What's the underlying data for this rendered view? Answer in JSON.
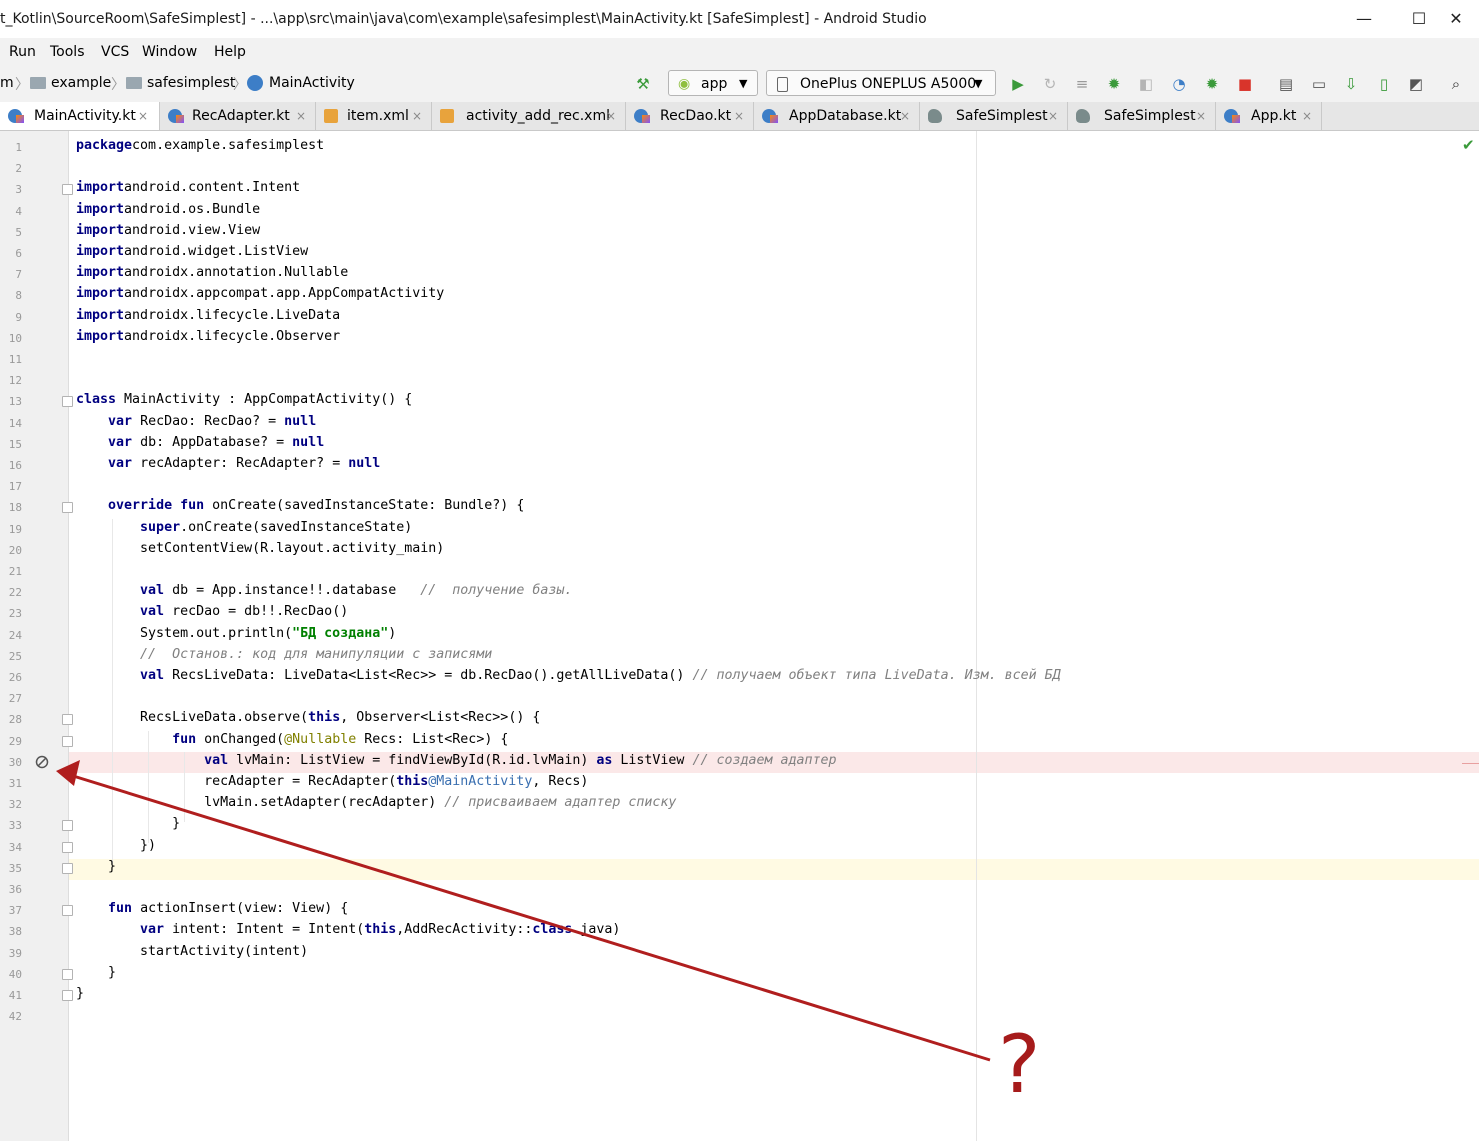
{
  "window": {
    "title": "t_Kotlin\\SourceRoom\\SafeSimplest] - ...\\app\\src\\main\\java\\com\\example\\safesimplest\\MainActivity.kt [SafeSimplest] - Android Studio",
    "minimize": "—",
    "maximize": "☐",
    "close": "✕"
  },
  "menu": [
    "Run",
    "Tools",
    "VCS",
    "Window",
    "Help"
  ],
  "breadcrumb": [
    "m",
    "example",
    "safesimplest",
    "MainActivity"
  ],
  "toolbar": {
    "config": "app",
    "device": "OnePlus ONEPLUS A5000"
  },
  "tabs": [
    {
      "label": "MainActivity.kt",
      "icon": "kotlin-class-icon"
    },
    {
      "label": "RecAdapter.kt",
      "icon": "kotlin-class-icon"
    },
    {
      "label": "item.xml",
      "icon": "xml-file-icon"
    },
    {
      "label": "activity_add_rec.xml",
      "icon": "xml-file-icon"
    },
    {
      "label": "RecDao.kt",
      "icon": "kotlin-class-icon"
    },
    {
      "label": "AppDatabase.kt",
      "icon": "kotlin-class-icon"
    },
    {
      "label": "SafeSimplest",
      "icon": "project-icon"
    },
    {
      "label": "SafeSimplest",
      "icon": "project-icon"
    },
    {
      "label": "App.kt",
      "icon": "kotlin-class-icon"
    }
  ],
  "close_glyph": "×",
  "code": {
    "lines": [
      [
        [
          "kw",
          "package"
        ],
        [
          "",
          "com.example.safesimplest"
        ]
      ],
      [],
      [
        [
          "kw",
          "import"
        ],
        [
          "",
          "android.content.Intent"
        ]
      ],
      [
        [
          "kw",
          "import"
        ],
        [
          "",
          "android.os.Bundle"
        ]
      ],
      [
        [
          "kw",
          "import"
        ],
        [
          "",
          "android.view.View"
        ]
      ],
      [
        [
          "kw",
          "import"
        ],
        [
          "",
          "android.widget.ListView"
        ]
      ],
      [
        [
          "kw",
          "import"
        ],
        [
          "",
          "androidx.annotation.Nullable"
        ]
      ],
      [
        [
          "kw",
          "import"
        ],
        [
          "",
          "androidx.appcompat.app.AppCompatActivity"
        ]
      ],
      [
        [
          "kw",
          "import"
        ],
        [
          "",
          "androidx.lifecycle.LiveData"
        ]
      ],
      [
        [
          "kw",
          "import"
        ],
        [
          "",
          "androidx.lifecycle.Observer"
        ]
      ],
      [],
      [],
      [
        [
          "kw",
          "class"
        ],
        [
          "",
          " MainActivity : AppCompatActivity() {"
        ]
      ],
      [
        [
          "",
          "    "
        ],
        [
          "kw",
          "var"
        ],
        [
          "",
          " RecDao: RecDao? = "
        ],
        [
          "kw",
          "null"
        ]
      ],
      [
        [
          "",
          "    "
        ],
        [
          "kw",
          "var"
        ],
        [
          "",
          " db: AppDatabase? = "
        ],
        [
          "kw",
          "null"
        ]
      ],
      [
        [
          "",
          "    "
        ],
        [
          "kw",
          "var"
        ],
        [
          "",
          " recAdapter: RecAdapter? = "
        ],
        [
          "kw",
          "null"
        ]
      ],
      [],
      [
        [
          "",
          "    "
        ],
        [
          "kw",
          "override fun"
        ],
        [
          "",
          " onCreate(savedInstanceState: Bundle?) {"
        ]
      ],
      [
        [
          "",
          "        "
        ],
        [
          "kw",
          "super"
        ],
        [
          "",
          ".onCreate(savedInstanceState)"
        ]
      ],
      [
        [
          "",
          "        setContentView(R.layout.activity_main)"
        ]
      ],
      [],
      [
        [
          "",
          "        "
        ],
        [
          "kw",
          "val"
        ],
        [
          "",
          " db = App.instance!!.database   "
        ],
        [
          "cm",
          "//  получение базы."
        ]
      ],
      [
        [
          "",
          "        "
        ],
        [
          "kw",
          "val"
        ],
        [
          "",
          " recDao = db!!.RecDao()"
        ]
      ],
      [
        [
          "",
          "        System.out.println("
        ],
        [
          "str",
          "\"БД создана\""
        ],
        [
          "",
          ")"
        ]
      ],
      [
        [
          "",
          "        "
        ],
        [
          "cm",
          "//  Останов.: код для манипуляции с записями"
        ]
      ],
      [
        [
          "",
          "        "
        ],
        [
          "kw",
          "val"
        ],
        [
          "",
          " RecsLiveData: LiveData<List<Rec>> = db.RecDao().getAllLiveData() "
        ],
        [
          "cm",
          "// получаем объект типа LiveData. Изм. всей БД"
        ]
      ],
      [],
      [
        [
          "",
          "        RecsLiveData.observe("
        ],
        [
          "kw",
          "this"
        ],
        [
          "",
          ", Observer<List<Rec>>() {"
        ]
      ],
      [
        [
          "",
          "            "
        ],
        [
          "kw",
          "fun"
        ],
        [
          "",
          " onChanged("
        ],
        [
          "ann",
          "@Nullable"
        ],
        [
          "",
          " Recs: List<Rec>) {"
        ]
      ],
      [
        [
          "",
          "                "
        ],
        [
          "kw",
          "val"
        ],
        [
          "",
          " lvMain: ListView = findViewById(R.id.lvMain) "
        ],
        [
          "kw",
          "as"
        ],
        [
          "",
          " ListView "
        ],
        [
          "cm",
          "// создаем адаптер"
        ]
      ],
      [
        [
          "",
          "                recAdapter = RecAdapter("
        ],
        [
          "kw",
          "this"
        ],
        [
          "lbl",
          "@MainActivity"
        ],
        [
          "",
          ", Recs)"
        ]
      ],
      [
        [
          "",
          "                lvMain.setAdapter(recAdapter) "
        ],
        [
          "cm",
          "// присваиваем адаптер списку"
        ]
      ],
      [
        [
          "",
          "            }"
        ]
      ],
      [
        [
          "",
          "        })"
        ]
      ],
      [
        [
          "",
          "    }"
        ]
      ],
      [],
      [
        [
          "",
          "    "
        ],
        [
          "kw",
          "fun"
        ],
        [
          "",
          " actionInsert(view: View) {"
        ]
      ],
      [
        [
          "",
          "        "
        ],
        [
          "kw",
          "var"
        ],
        [
          "",
          " intent: Intent = Intent("
        ],
        [
          "kw",
          "this"
        ],
        [
          "",
          ",AddRecActivity::"
        ],
        [
          "kw",
          "class"
        ],
        [
          "",
          ".java)"
        ]
      ],
      [
        [
          "",
          "        startActivity(intent)"
        ]
      ],
      [
        [
          "",
          "    }"
        ]
      ],
      [
        [
          "",
          "}"
        ]
      ],
      []
    ]
  },
  "annotation": {
    "text": "?",
    "color": "#a61b1b"
  }
}
